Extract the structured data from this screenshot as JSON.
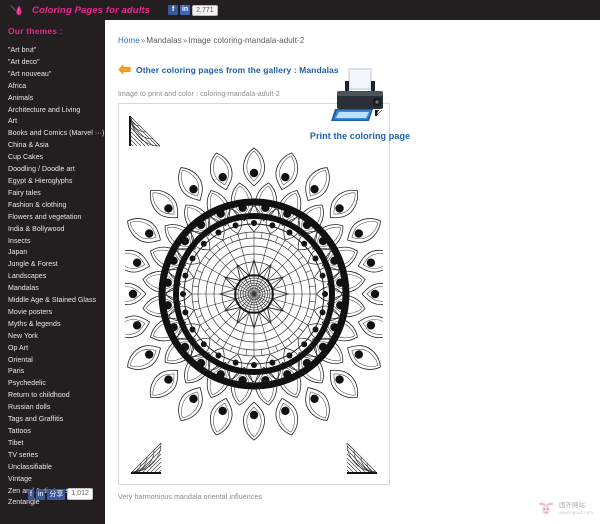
{
  "header": {
    "logo_icon": "paintbrush-icon",
    "site_title": "Coloring Pages for adults",
    "share": {
      "facebook_label": "f",
      "secondary_label": "in",
      "count": "2,771"
    }
  },
  "sidebar": {
    "heading": "Our themes :",
    "items": [
      {
        "label": "\"Art brut\""
      },
      {
        "label": "\"Art deco\""
      },
      {
        "label": "\"Art nouveau\""
      },
      {
        "label": "Africa"
      },
      {
        "label": "Animals"
      },
      {
        "label": "Architecture and Living"
      },
      {
        "label": "Art"
      },
      {
        "label": "Books and Comics (Marvel ···)"
      },
      {
        "label": "China & Asia"
      },
      {
        "label": "Cup Cakes"
      },
      {
        "label": "Doodling / Doodle art"
      },
      {
        "label": "Egypt & Hieroglyphs"
      },
      {
        "label": "Fairy tales"
      },
      {
        "label": "Fashion & clothing"
      },
      {
        "label": "Flowers and vegetation"
      },
      {
        "label": "India & Bollywood"
      },
      {
        "label": "Insects"
      },
      {
        "label": "Japan"
      },
      {
        "label": "Jungle & Forest"
      },
      {
        "label": "Landscapes"
      },
      {
        "label": "Mandalas"
      },
      {
        "label": "Middle Age & Stained Glass"
      },
      {
        "label": "Movie posters"
      },
      {
        "label": "Myths & legends"
      },
      {
        "label": "New York"
      },
      {
        "label": "Op Art"
      },
      {
        "label": "Oriental"
      },
      {
        "label": "Paris"
      },
      {
        "label": "Psychedelic"
      },
      {
        "label": "Return to childhood"
      },
      {
        "label": "Russian dolls"
      },
      {
        "label": "Tags and Graffitis"
      },
      {
        "label": "Tattoos"
      },
      {
        "label": "Tibet"
      },
      {
        "label": "TV series"
      },
      {
        "label": "Unclassifiable"
      },
      {
        "label": "Vintage"
      },
      {
        "label": "Zen and Anti stress"
      },
      {
        "label": "Zentangle"
      }
    ]
  },
  "main": {
    "breadcrumb": {
      "home": "Home",
      "sep1": "»",
      "category": "Mandalas",
      "sep2": "»",
      "current": "Image coloring-mandala-adult-2"
    },
    "gallery_link": {
      "icon": "arrow-left-icon",
      "label": "Other coloring pages from the gallery : Mandalas"
    },
    "image_caption_top": "Image to print and color : coloring-mandala-adult-2",
    "image_caption_bottom": "Very harmonious mandala oriental influences",
    "figure_alt": "coloring-mandala-adult-2"
  },
  "print": {
    "icon": "printer-icon",
    "link_label": "Print the coloring page"
  },
  "footer_share": {
    "facebook_label": "f",
    "secondary_label": "in",
    "share_label": "分享",
    "count": "1,012"
  },
  "watermark": {
    "icon": "watermark-mascot-icon",
    "cn_text": "国外网站",
    "url_text": "www.egouz.com"
  },
  "colors": {
    "sidebar_bg": "#231f20",
    "brand_pink": "#e8288f",
    "link_blue": "#1f5fa8",
    "breadcrumb_gray": "#5a5a5a",
    "caption_gray": "#8a8a8a",
    "frame_border": "#d8d8d8",
    "arrow_orange": "#f5a120"
  }
}
